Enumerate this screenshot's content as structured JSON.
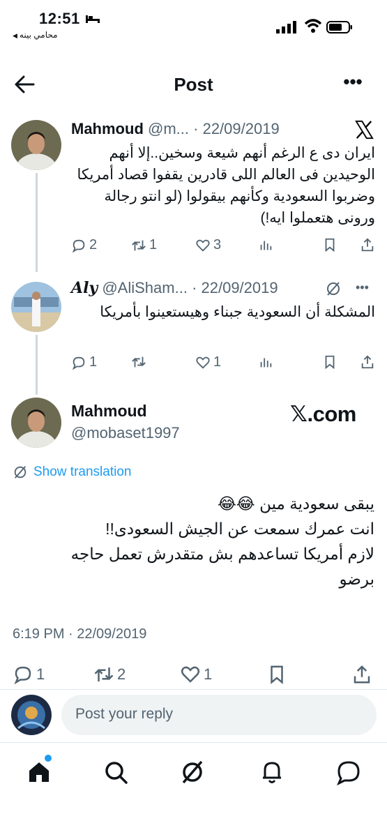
{
  "status_bar": {
    "time": "12:51",
    "back_app": "محامي بينه"
  },
  "header": {
    "title": "Post"
  },
  "tweets": [
    {
      "name": "Mahmoud",
      "handle": "@m...",
      "date": "· 22/09/2019",
      "text": "ايران دى ع الرغم أنهم شيعة وسخين..إلا أنهم الوحيدين فى العالم اللى قادرين يقفوا قصاد أمريكا وضربوا السعودية وكأنهم بيقولوا (لو انتو رجالة ورونى هتعملوا ايه!)",
      "replies": "2",
      "retweets": "1",
      "likes": "3"
    },
    {
      "name": "Aly",
      "handle": "@AliSham...",
      "date": "· 22/09/2019",
      "text": "المشكلة أن السعودية جبناء وهيستعينوا بأمريكا",
      "replies": "1",
      "retweets": "",
      "likes": "1"
    }
  ],
  "main_tweet": {
    "name": "Mahmoud",
    "handle": "@mobaset1997",
    "watermark": "𝕏.com",
    "show_translation": "Show translation",
    "lines": [
      "يبقى سعودية مين 😂😂",
      "انت عمرك سمعت عن الجيش السعودى!!",
      "لازم أمريكا تساعدهم بش متقدرش تعمل حاجه برضو"
    ],
    "timestamp": "6:19 PM · 22/09/2019",
    "replies": "1",
    "retweets": "2",
    "likes": "1"
  },
  "reply": {
    "placeholder": "Post your reply"
  },
  "colors": {
    "accent": "#1d9bf0",
    "muted": "#536471",
    "text": "#0f1419"
  }
}
